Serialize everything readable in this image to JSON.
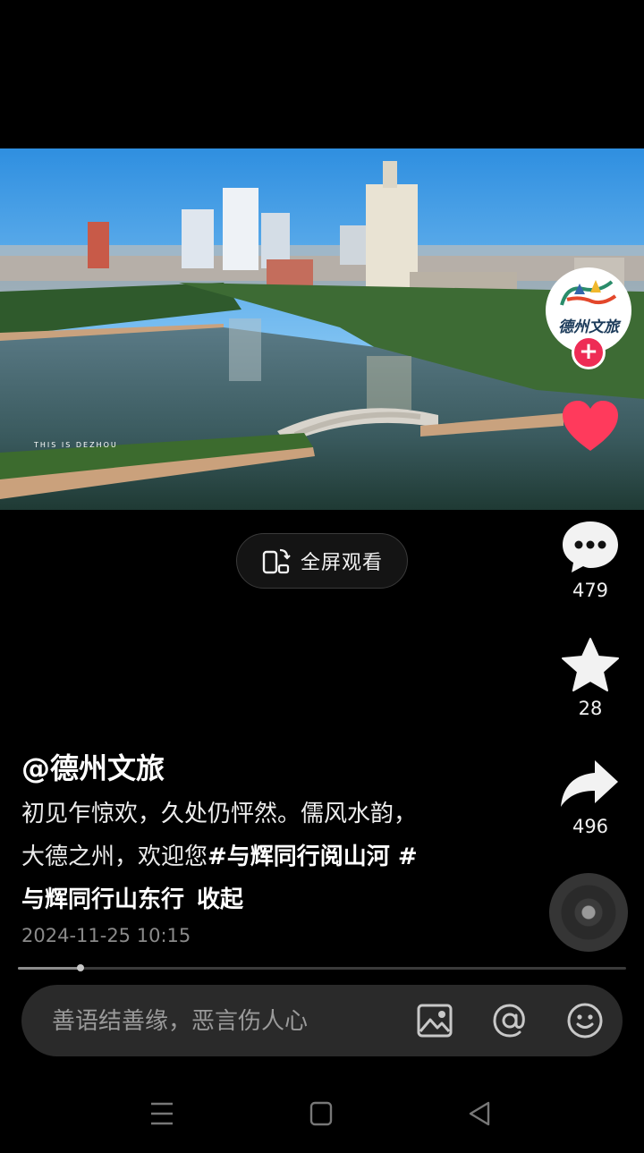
{
  "video": {
    "watermark": "THIS IS DEZHOU"
  },
  "fullscreen": {
    "label": "全屏观看"
  },
  "author_account": {
    "avatar_text": "德州文旅"
  },
  "actions": {
    "comment_count": "479",
    "favorite_count": "28",
    "share_count": "496"
  },
  "post": {
    "author": "@德州文旅",
    "caption_line1": "初见乍惊欢，久处仍怦然。儒风水韵，",
    "caption_line2_text": "大德之州，欢迎您",
    "tag1": "#与辉同行阅山河 #",
    "tag2": "与辉同行山东行",
    "collapse_label": "收起",
    "datetime": "2024-11-25 10:15"
  },
  "playback": {
    "progress_fraction": 0.103
  },
  "comment_bar": {
    "placeholder": "善语结善缘，恶言伤人心"
  },
  "colors": {
    "accent": "#ee2c55",
    "like": "#ff3a5c"
  }
}
